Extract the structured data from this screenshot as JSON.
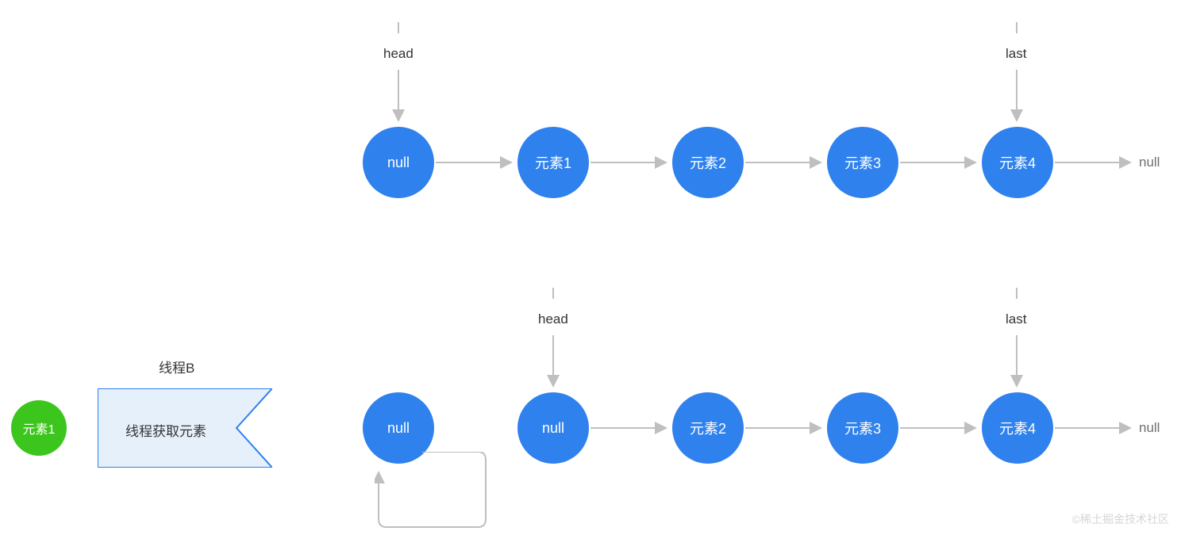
{
  "pointers": {
    "head": "head",
    "last": "last"
  },
  "row1": {
    "nodes": [
      "null",
      "元素1",
      "元素2",
      "元素3",
      "元素4"
    ],
    "tail_null": "null"
  },
  "row2": {
    "detached_node": "null",
    "nodes": [
      "null",
      "元素2",
      "元素3",
      "元素4"
    ],
    "tail_null": "null"
  },
  "thread": {
    "title": "线程B",
    "action": "线程获取元素",
    "element": "元素1"
  },
  "colors": {
    "node_blue": "#2f81ed",
    "node_green": "#3cc61d",
    "pentagon_fill": "#e6f0fa",
    "pentagon_stroke": "#2f81ed",
    "arrow": "#bfbfbf",
    "text": "#333333"
  },
  "watermark": "©稀土掘金技术社区"
}
